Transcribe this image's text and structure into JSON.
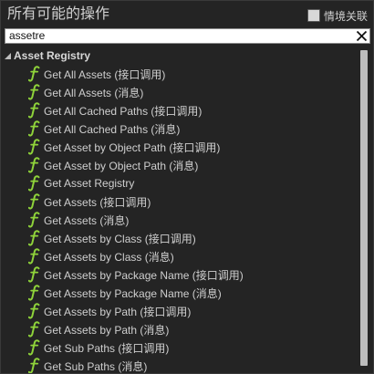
{
  "header": {
    "title": "所有可能的操作",
    "context_sensitive_label": "情境关联"
  },
  "search": {
    "value": "assetre",
    "clear_icon": "close-icon"
  },
  "category": {
    "label": "Asset Registry",
    "icon": "expanded-triangle-icon"
  },
  "items": [
    {
      "label": "Get All Assets (接口调用)"
    },
    {
      "label": "Get All Assets (消息)"
    },
    {
      "label": "Get All Cached Paths (接口调用)"
    },
    {
      "label": "Get All Cached Paths (消息)"
    },
    {
      "label": "Get Asset by Object Path (接口调用)"
    },
    {
      "label": "Get Asset by Object Path (消息)"
    },
    {
      "label": "Get Asset Registry"
    },
    {
      "label": "Get Assets (接口调用)"
    },
    {
      "label": "Get Assets (消息)"
    },
    {
      "label": "Get Assets by Class (接口调用)"
    },
    {
      "label": "Get Assets by Class (消息)"
    },
    {
      "label": "Get Assets by Package Name (接口调用)"
    },
    {
      "label": "Get Assets by Package Name (消息)"
    },
    {
      "label": "Get Assets by Path (接口调用)"
    },
    {
      "label": "Get Assets by Path (消息)"
    },
    {
      "label": "Get Sub Paths (接口调用)"
    },
    {
      "label": "Get Sub Paths (消息)"
    }
  ],
  "item_icon": "function-icon",
  "colors": {
    "panel_bg": "#242424",
    "function_icon": "#8fd33a",
    "text": "#cfcfcf"
  }
}
